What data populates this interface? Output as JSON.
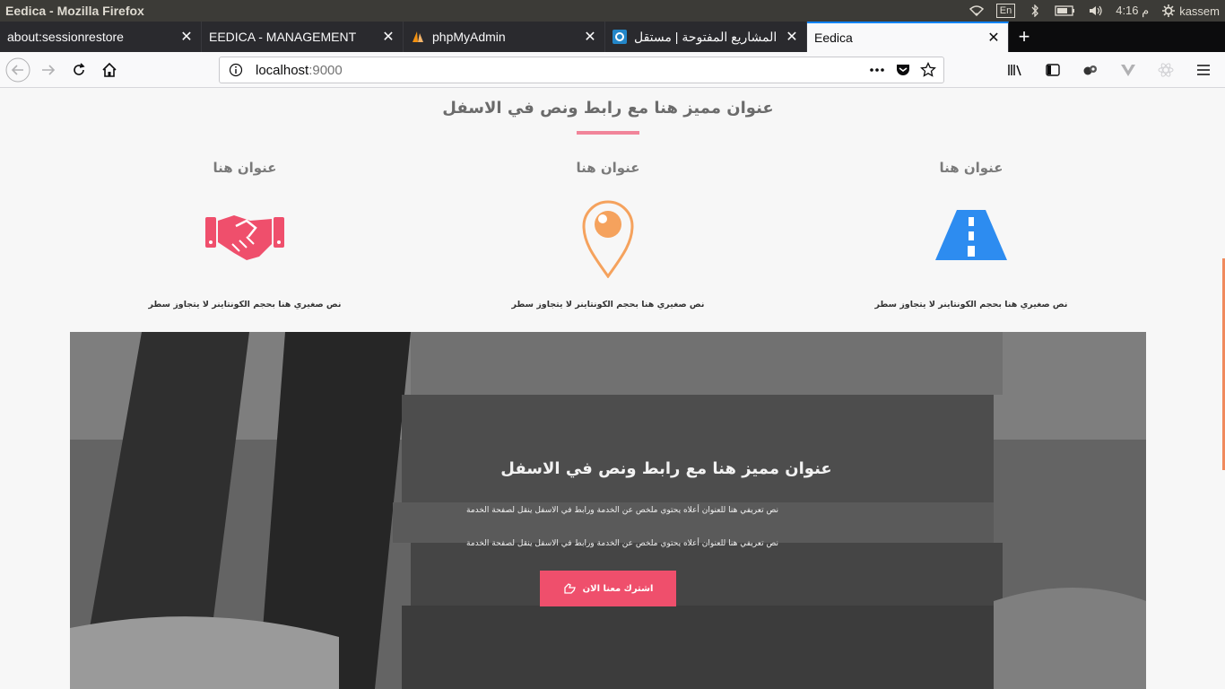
{
  "os": {
    "window_title": "Eedica - Mozilla Firefox",
    "lang": "En",
    "time": "4:16 م",
    "user": "kassem"
  },
  "tabs": [
    {
      "label": "about:sessionrestore",
      "icon": "none"
    },
    {
      "label": "EEDICA - MANAGEMENT",
      "icon": "none"
    },
    {
      "label": "phpMyAdmin",
      "icon": "phpmyadmin-icon"
    },
    {
      "label": "المشاريع المفتوحة | مستقل",
      "icon": "mostaql-icon"
    },
    {
      "label": "Eedica",
      "icon": "none",
      "active": true
    }
  ],
  "urlbar": {
    "host": "localhost",
    "port": ":9000"
  },
  "section": {
    "title": "عنوان مميز هنا مع رابط ونص في الاسفل",
    "accent": "#f1859a"
  },
  "features": [
    {
      "title": "عنوان هنا",
      "icon": "road-icon",
      "text": "نص صغيري هنا بحجم الكونتاينر لا يتجاوز سطر",
      "color": "#2d8cf0"
    },
    {
      "title": "عنوان هنا",
      "icon": "map-pin-icon",
      "text": "نص صغيري هنا بحجم الكونتاينر لا يتجاوز سطر",
      "color": "#f5a25d"
    },
    {
      "title": "عنوان هنا",
      "icon": "handshake-icon",
      "text": "نص صغيري هنا بحجم الكونتاينر لا يتجاوز سطر",
      "color": "#ef4f6c"
    }
  ],
  "hero": {
    "title": "عنوان مميز هنا مع رابط ونص في الاسفل",
    "text1": "نص تعريفي هنا للعنوان أعلاه يحتوي ملخص عن الخدمة ورابط في الاسفل ينقل لصفحة الخدمة",
    "text2": "نص تعريفي هنا للعنوان أعلاه يحتوي ملخص عن الخدمة ورابط في الاسفل ينقل لصفحة الخدمة",
    "button_label": "اشترك معنا الان",
    "button_color": "#ef4f6c"
  }
}
